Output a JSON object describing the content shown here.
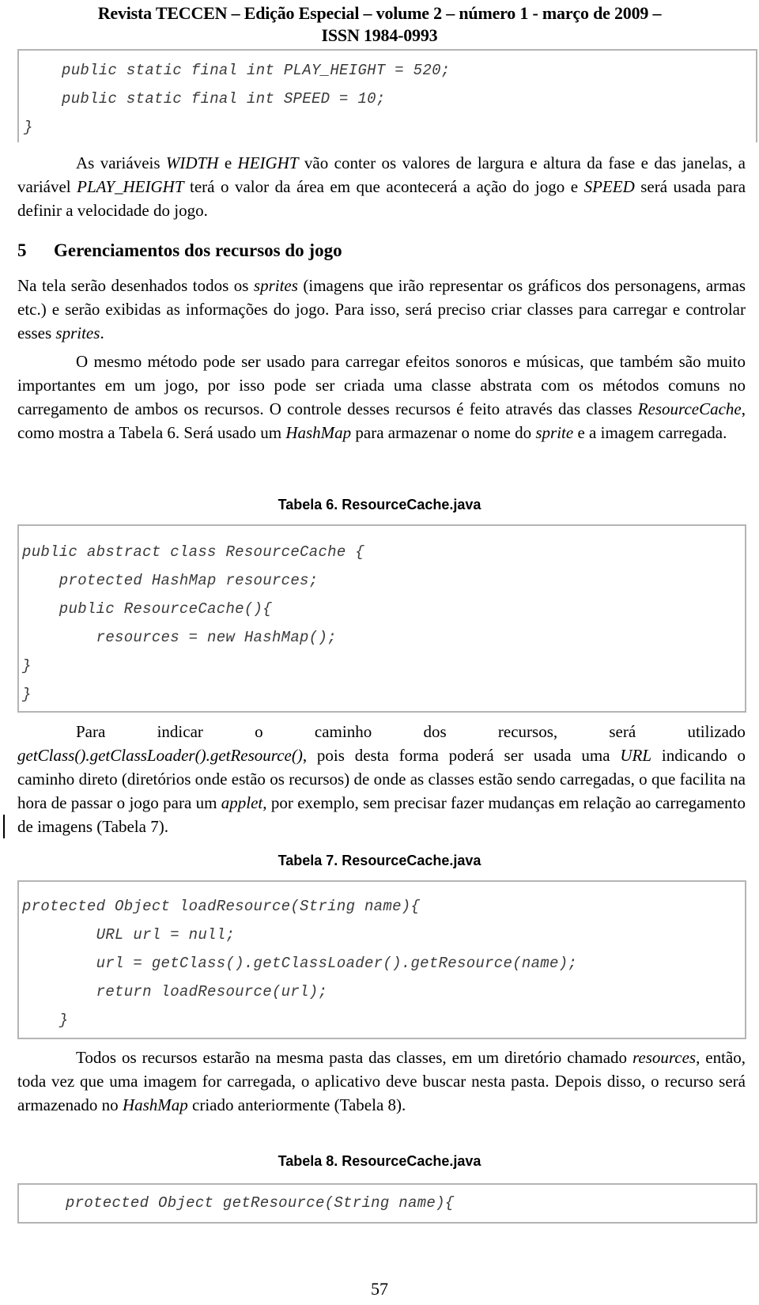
{
  "header": {
    "line1": "Revista TECCEN – Edição Especial – volume 2 – número 1 - março de 2009 –",
    "line2": "ISSN 1984-0993"
  },
  "code_block_1": {
    "lines": [
      "public static final int PLAY_HEIGHT = 520;",
      "public static final int SPEED = 10;",
      "}"
    ]
  },
  "paragraph_1": {
    "segments": [
      {
        "text": "As variáveis ",
        "italic": false
      },
      {
        "text": "WIDTH",
        "italic": true
      },
      {
        "text": " e ",
        "italic": false
      },
      {
        "text": "HEIGHT",
        "italic": true
      },
      {
        "text": " vão conter os valores de largura e altura da fase e das janelas, a variável ",
        "italic": false
      },
      {
        "text": "PLAY_HEIGHT",
        "italic": true
      },
      {
        "text": " terá o valor da área em que acontecerá a ação do jogo e ",
        "italic": false
      },
      {
        "text": "SPEED",
        "italic": true
      },
      {
        "text": " será usada para definir a velocidade do jogo.",
        "italic": false
      }
    ]
  },
  "section": {
    "number": "5",
    "title": "Gerenciamentos dos recursos do jogo"
  },
  "paragraph_2": {
    "segments": [
      {
        "text": "Na tela serão desenhados todos os ",
        "italic": false
      },
      {
        "text": "sprites",
        "italic": true
      },
      {
        "text": " (imagens que irão representar os gráficos dos personagens, armas etc.) e serão exibidas as informações do jogo. Para isso, será preciso criar classes para carregar e controlar esses ",
        "italic": false
      },
      {
        "text": "sprites",
        "italic": true
      },
      {
        "text": ".",
        "italic": false
      }
    ]
  },
  "paragraph_3": {
    "segments": [
      {
        "text": "O mesmo método pode ser usado para carregar efeitos sonoros e músicas, que também são muito importantes em um jogo, por isso pode ser criada uma classe abstrata com os métodos comuns no carregamento de ambos os recursos. O controle desses recursos é feito através das classes ",
        "italic": false
      },
      {
        "text": "ResourceCache",
        "italic": true
      },
      {
        "text": ", como mostra a Tabela 6. Será usado um ",
        "italic": false
      },
      {
        "text": "HashMap",
        "italic": true
      },
      {
        "text": " para armazenar o nome do ",
        "italic": false
      },
      {
        "text": "sprite",
        "italic": true
      },
      {
        "text": " e a imagem carregada.",
        "italic": false
      }
    ]
  },
  "table_6": {
    "caption": "Tabela 6. ResourceCache.java",
    "lines": [
      "public abstract class ResourceCache {",
      "    protected HashMap resources;",
      "    public ResourceCache(){",
      "        resources = new HashMap();",
      "}",
      "}"
    ]
  },
  "paragraph_4": {
    "line1_words": [
      "Para",
      "indicar",
      "o",
      "caminho",
      "dos",
      "recursos,",
      "será",
      "utilizado"
    ],
    "segments": [
      {
        "text": "getClass().getClassLoader().getResource()",
        "italic": true
      },
      {
        "text": ", pois desta forma poderá ser usada uma ",
        "italic": false
      },
      {
        "text": "URL",
        "italic": true
      },
      {
        "text": " indicando o caminho direto (diretórios onde estão os recursos) de onde as classes estão sendo carregadas, o que facilita na hora de passar o jogo para um ",
        "italic": false
      },
      {
        "text": "applet",
        "italic": true
      },
      {
        "text": ", por exemplo, sem precisar fazer mudanças em relação ao carregamento de imagens (Tabela 7).",
        "italic": false
      }
    ]
  },
  "table_7": {
    "caption": "Tabela 7. ResourceCache.java",
    "lines": [
      "protected Object loadResource(String name){",
      "        URL url = null;",
      "        url = getClass().getClassLoader().getResource(name);",
      "        return loadResource(url);",
      "    }"
    ]
  },
  "paragraph_5": {
    "segments": [
      {
        "text": "Todos os recursos estarão na mesma pasta das classes, em um diretório chamado ",
        "italic": false
      },
      {
        "text": "resources",
        "italic": true
      },
      {
        "text": ", então, toda vez que uma imagem for carregada, o aplicativo deve buscar nesta pasta. Depois disso, o recurso será armazenado no ",
        "italic": false
      },
      {
        "text": "HashMap",
        "italic": true
      },
      {
        "text": " criado anteriormente (Tabela 8).",
        "italic": false
      }
    ]
  },
  "table_8": {
    "caption": "Tabela 8. ResourceCache.java",
    "lines": [
      "protected Object getResource(String name){"
    ]
  },
  "footer": {
    "page_number": "57"
  }
}
